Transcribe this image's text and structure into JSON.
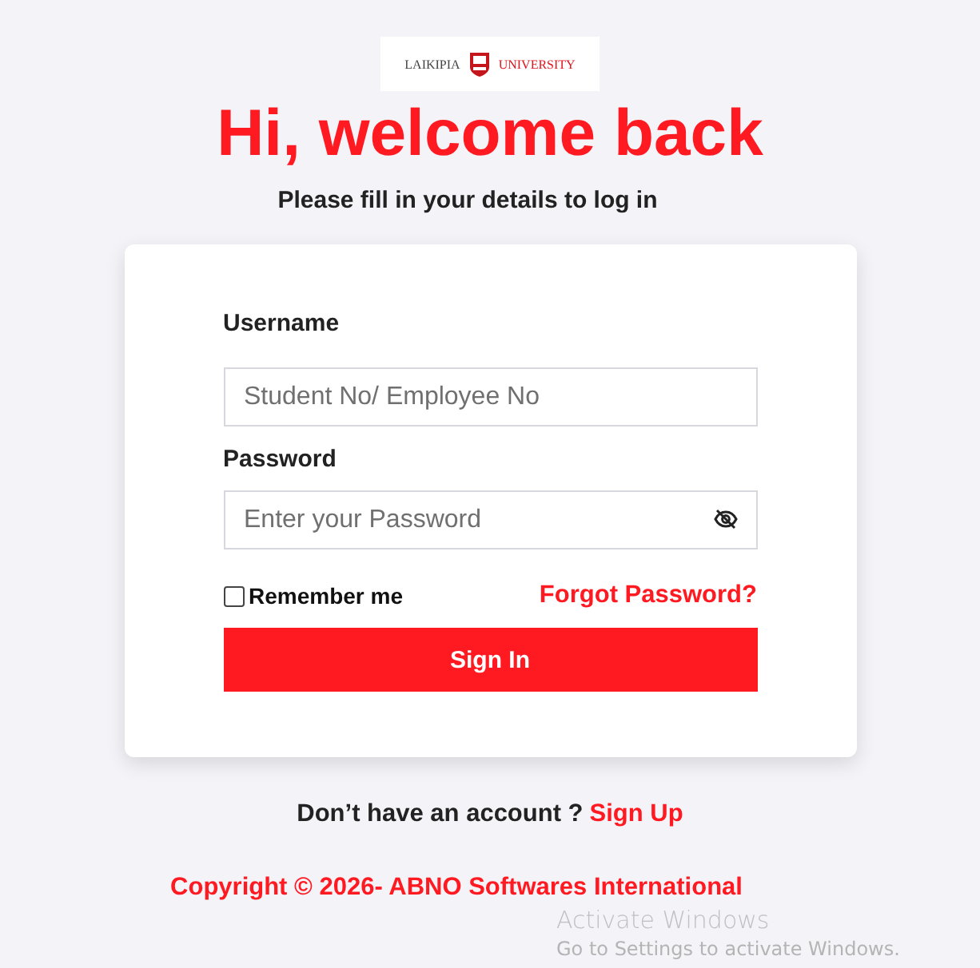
{
  "logo": {
    "left_text": "LAIKIPIA",
    "right_text": "UNIVERSITY"
  },
  "heading": "Hi, welcome back",
  "subtitle": "Please fill in your details to log in",
  "form": {
    "username": {
      "label": "Username",
      "placeholder": "Student No/ Employee No"
    },
    "password": {
      "label": "Password",
      "placeholder": "Enter your Password"
    },
    "remember": {
      "label": "Remember me",
      "checked": false
    },
    "forgot_link": "Forgot Password?",
    "submit": "Sign In"
  },
  "signup": {
    "prompt": "Don’t have an account ?",
    "link": "Sign Up"
  },
  "copyright": "Copyright © 2026- ABNO Softwares International",
  "system_notice": {
    "title": "Activate Windows",
    "message": "Go to Settings to activate Windows."
  }
}
